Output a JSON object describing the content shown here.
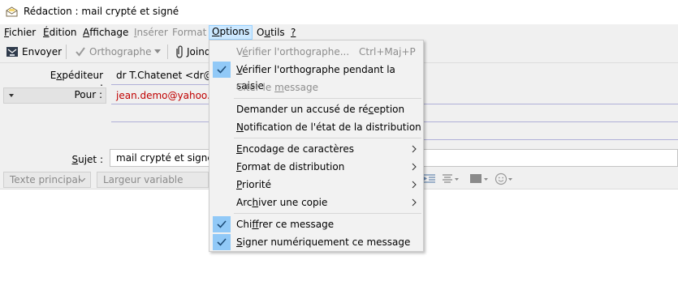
{
  "window": {
    "title": "Rédaction : mail crypté et signé",
    "icon": "compose-mail-icon"
  },
  "menubar": {
    "items": [
      {
        "pre": "",
        "key": "F",
        "post": "ichier"
      },
      {
        "pre": "",
        "key": "É",
        "post": "dition"
      },
      {
        "pre": "",
        "key": "A",
        "post": "ffichage"
      },
      {
        "pre": "",
        "key": "I",
        "post": "nsérer"
      },
      {
        "pre": "",
        "key": "",
        "post": "Format"
      },
      {
        "pre": "",
        "key": "O",
        "post": "ptions"
      },
      {
        "pre": "O",
        "key": "u",
        "post": "tils"
      },
      {
        "pre": "",
        "key": "?",
        "post": ""
      }
    ]
  },
  "toolbar": {
    "send": "Envoyer",
    "spelling": "Orthographe",
    "attach": "Joind"
  },
  "headers": {
    "from_label_pre": "E",
    "from_label_key": "x",
    "from_label_post": "péditeur :",
    "from_value": "dr T.Chatenet <dr@ch",
    "to_label": "Pour :",
    "to_value": "jean.demo@yahoo.fr",
    "subject_label_key": "S",
    "subject_label_post": "ujet :",
    "subject_value": "mail crypté et signé"
  },
  "format_bar": {
    "paragraph": "Texte principal",
    "font": "Largeur variable"
  },
  "options_menu": [
    {
      "pre": "V",
      "key": "é",
      "post": "rifier l'orthographe...",
      "shortcut": "Ctrl+Maj+P",
      "disabled": true,
      "checked": false
    },
    {
      "pre": "",
      "key": "V",
      "post": "érifier l'orthographe pendant la saisie",
      "checked": true
    },
    {
      "pre": "Citer le ",
      "key": "m",
      "post": "essage",
      "disabled": true
    },
    {
      "pre": "Demander un accusé de ré",
      "key": "c",
      "post": "eption"
    },
    {
      "pre": "",
      "key": "N",
      "post": "otification de l'état de la distribution"
    },
    {
      "pre": "",
      "key": "E",
      "post": "ncodage de caractères",
      "submenu": true
    },
    {
      "pre": "",
      "key": "F",
      "post": "ormat de distribution",
      "submenu": true
    },
    {
      "pre": "",
      "key": "P",
      "post": "riorité",
      "submenu": true
    },
    {
      "pre": "Arc",
      "key": "h",
      "post": "iver une copie",
      "submenu": true
    },
    {
      "pre": "Chi",
      "key": "f",
      "post": "frer ce message",
      "checked": true
    },
    {
      "pre": "",
      "key": "S",
      "post": "igner numériquement ce message",
      "checked": true
    }
  ],
  "colors": {
    "menu_highlight": "#cce8ff",
    "check_bg": "#91c9f7",
    "recipient": "#c00000"
  }
}
